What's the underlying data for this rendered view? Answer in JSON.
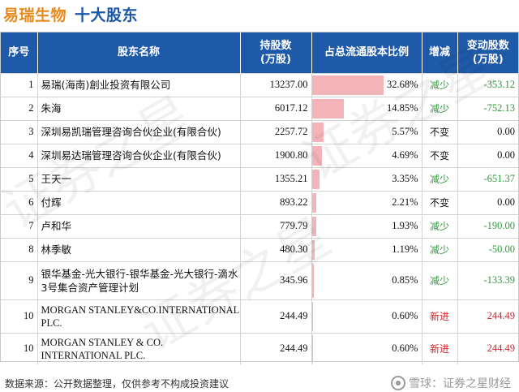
{
  "header": {
    "company": "易瑞生物",
    "subtitle": "十大股东"
  },
  "colors": {
    "company": "#e8891b",
    "subtitle": "#1a57a8",
    "header_bg": "#1f5aa9",
    "bar": "#f4b3b9",
    "decrease": "#2e9a3a",
    "increase": "#d8222a"
  },
  "chart_data": {
    "type": "table",
    "columns": [
      "序号",
      "股东名称",
      "持股数\n(万股)",
      "占总流通股本比例",
      "增减",
      "变动股数\n(万股)"
    ],
    "rows": [
      {
        "rank": "1",
        "name": "易瑞(海南)創业投资有限公司",
        "shares": "13237.00",
        "ratio": "32.68%",
        "ratio_value": 32.68,
        "change": "减少",
        "delta": "-353.12",
        "dir": "dec"
      },
      {
        "rank": "2",
        "name": "朱海",
        "shares": "6017.12",
        "ratio": "14.85%",
        "ratio_value": 14.85,
        "change": "减少",
        "delta": "-752.13",
        "dir": "dec"
      },
      {
        "rank": "3",
        "name": "深圳易凯瑞管理咨询合伙企业(有限合伙)",
        "shares": "2257.72",
        "ratio": "5.57%",
        "ratio_value": 5.57,
        "change": "不变",
        "delta": "0.00",
        "dir": "same"
      },
      {
        "rank": "4",
        "name": "深圳易达瑞管理咨询合伙企业(有限合伙)",
        "shares": "1900.80",
        "ratio": "4.69%",
        "ratio_value": 4.69,
        "change": "不变",
        "delta": "0.00",
        "dir": "same"
      },
      {
        "rank": "5",
        "name": "王天一",
        "shares": "1355.21",
        "ratio": "3.35%",
        "ratio_value": 3.35,
        "change": "减少",
        "delta": "-651.37",
        "dir": "dec"
      },
      {
        "rank": "6",
        "name": "付辉",
        "shares": "893.22",
        "ratio": "2.21%",
        "ratio_value": 2.21,
        "change": "不变",
        "delta": "0.00",
        "dir": "same"
      },
      {
        "rank": "7",
        "name": "卢和华",
        "shares": "779.79",
        "ratio": "1.93%",
        "ratio_value": 1.93,
        "change": "减少",
        "delta": "-190.00",
        "dir": "dec"
      },
      {
        "rank": "8",
        "name": "林季敏",
        "shares": "480.30",
        "ratio": "1.19%",
        "ratio_value": 1.19,
        "change": "减少",
        "delta": "-50.00",
        "dir": "dec"
      },
      {
        "rank": "9",
        "name": "银华基金-光大银行-银华基金-光大银行-滴水3号集合资产管理计划",
        "shares": "345.96",
        "ratio": "0.85%",
        "ratio_value": 0.85,
        "change": "减少",
        "delta": "-133.39",
        "dir": "dec"
      },
      {
        "rank": "10",
        "name": "MORGAN STANLEY&CO.INTERNATIONAL PLC.",
        "shares": "244.49",
        "ratio": "0.60%",
        "ratio_value": 0.6,
        "change": "新进",
        "delta": "244.49",
        "dir": "inc"
      },
      {
        "rank": "10",
        "name": "MORGAN STANLEY & CO. INTERNATIONAL PLC.",
        "shares": "244.49",
        "ratio": "0.60%",
        "ratio_value": 0.6,
        "change": "新进",
        "delta": "244.49",
        "dir": "inc"
      }
    ]
  },
  "footer": {
    "source": "数据来源：公开数据整理，仅供参考不构成投资建议",
    "brand": "雪球：证券之星财经"
  },
  "watermark": {
    "text": "证券之星"
  }
}
